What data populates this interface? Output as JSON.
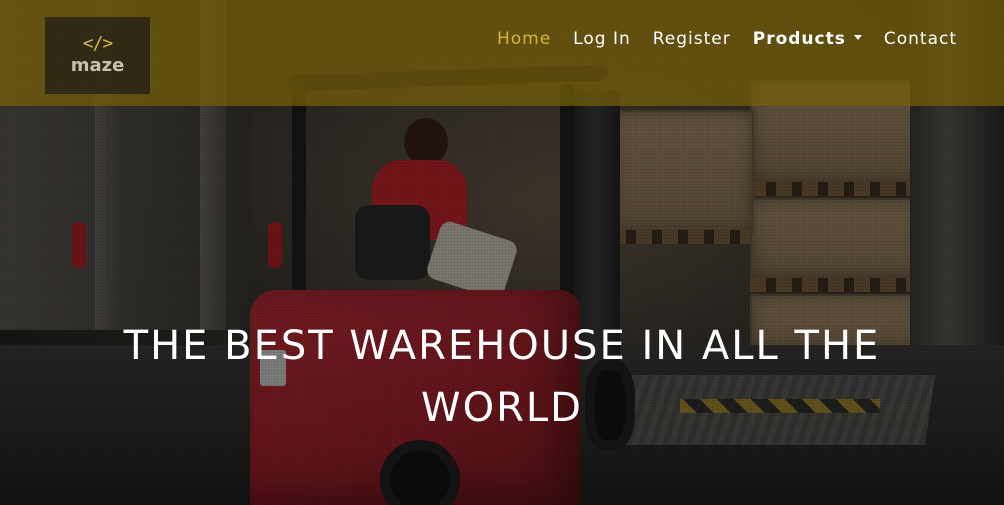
{
  "logo": {
    "icon": "</>",
    "text": "maze"
  },
  "nav": {
    "items": [
      {
        "label": "Home",
        "active": true
      },
      {
        "label": "Log In"
      },
      {
        "label": "Register"
      },
      {
        "label": "Products",
        "dropdown": true
      },
      {
        "label": "Contact"
      }
    ]
  },
  "hero": {
    "line1": "THE BEST WAREHOUSE IN ALL THE",
    "line2": "WORLD"
  },
  "colors": {
    "accent": "#d9b537",
    "navbar": "#766008"
  }
}
